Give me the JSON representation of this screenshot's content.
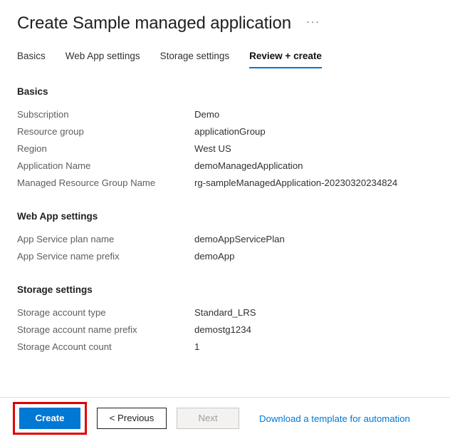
{
  "header": {
    "title": "Create Sample managed application",
    "overflow_label": "···"
  },
  "tabs": [
    {
      "label": "Basics",
      "active": false
    },
    {
      "label": "Web App settings",
      "active": false
    },
    {
      "label": "Storage settings",
      "active": false
    },
    {
      "label": "Review + create",
      "active": true
    }
  ],
  "sections": [
    {
      "title": "Basics",
      "rows": [
        {
          "label": "Subscription",
          "value": "Demo"
        },
        {
          "label": "Resource group",
          "value": "applicationGroup"
        },
        {
          "label": "Region",
          "value": "West US"
        },
        {
          "label": "Application Name",
          "value": "demoManagedApplication"
        },
        {
          "label": "Managed Resource Group Name",
          "value": "rg-sampleManagedApplication-20230320234824"
        }
      ]
    },
    {
      "title": "Web App settings",
      "rows": [
        {
          "label": "App Service plan name",
          "value": "demoAppServicePlan"
        },
        {
          "label": "App Service name prefix",
          "value": "demoApp"
        }
      ]
    },
    {
      "title": "Storage settings",
      "rows": [
        {
          "label": "Storage account type",
          "value": "Standard_LRS"
        },
        {
          "label": "Storage account name prefix",
          "value": "demostg1234"
        },
        {
          "label": "Storage Account count",
          "value": "1"
        }
      ]
    }
  ],
  "footer": {
    "create_label": "Create",
    "previous_label": "< Previous",
    "next_label": "Next",
    "download_link_label": "Download a template for automation"
  },
  "colors": {
    "accent": "#0078d4",
    "annotation": "#e00000",
    "label_text": "#605e5c",
    "value_text": "#323130",
    "disabled_text": "#a19f9d"
  }
}
